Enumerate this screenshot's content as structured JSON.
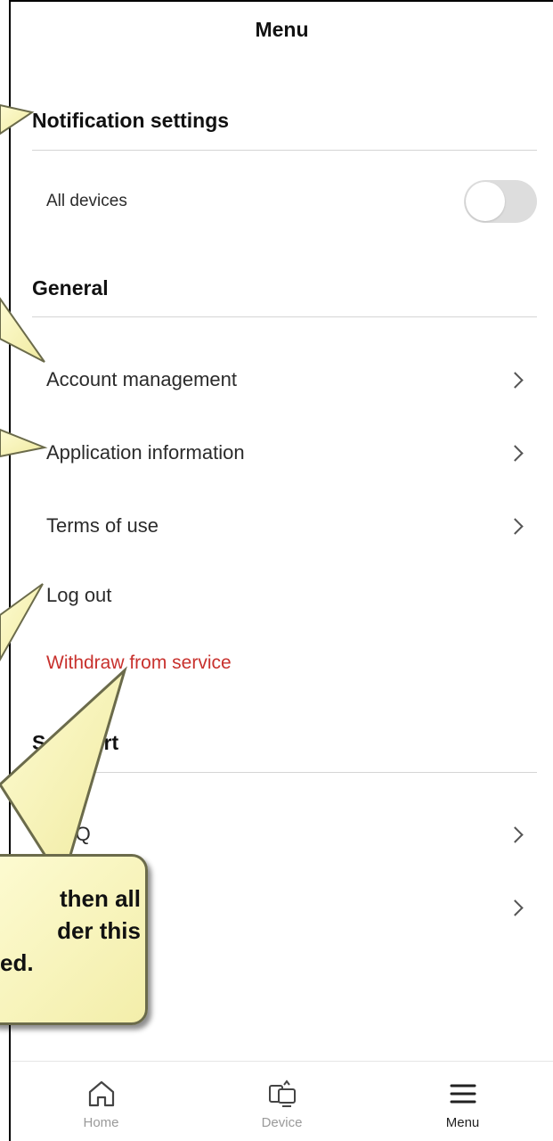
{
  "header": {
    "title": "Menu"
  },
  "sections": {
    "notification": {
      "heading": "Notification settings",
      "all_devices_label": "All devices",
      "all_devices_on": false
    },
    "general": {
      "heading": "General",
      "items": [
        {
          "label": "Account management"
        },
        {
          "label": "Application information"
        },
        {
          "label": "Terms of use"
        },
        {
          "label": "Log out"
        },
        {
          "label": "Withdraw from service"
        }
      ]
    },
    "support": {
      "heading_visible": "S        ort",
      "items": [
        {
          "label": "AQ"
        },
        {
          "label": ""
        }
      ]
    }
  },
  "callout": {
    "line1": "then all",
    "line2": "der this",
    "line3": "ed."
  },
  "bottom_nav": [
    {
      "label": "Home",
      "icon": "home-icon",
      "active": false
    },
    {
      "label": "Device",
      "icon": "device-icon",
      "active": false
    },
    {
      "label": "Menu",
      "icon": "menu-icon",
      "active": true
    }
  ],
  "colors": {
    "danger": "#c8312d",
    "callout_fill": "#f7f3b8",
    "toggle_off": "#dddddd"
  }
}
